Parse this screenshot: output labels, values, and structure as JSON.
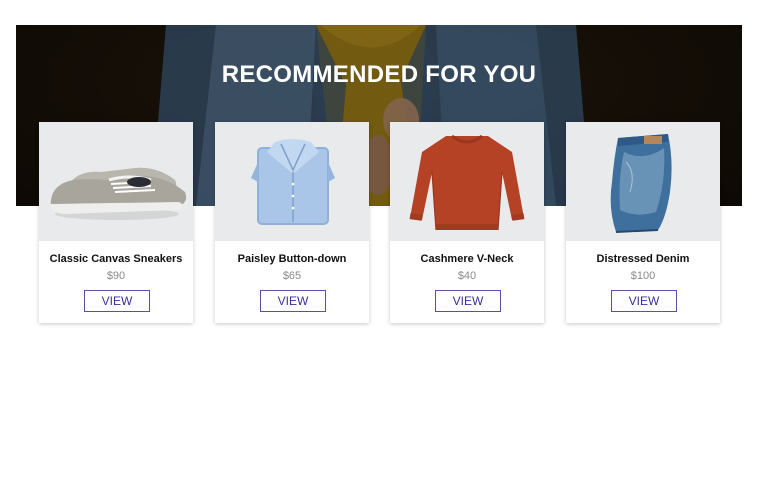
{
  "banner": {
    "title": "RECOMMENDED FOR YOU"
  },
  "colors": {
    "accent": "#3b2fa0",
    "price": "#8a8a8a",
    "card_bg": "#ffffff",
    "image_bg": "#e9eaec"
  },
  "products": [
    {
      "name": "Classic Canvas Sneakers",
      "price": "$90",
      "button": "VIEW",
      "icon": "sneakers-image"
    },
    {
      "name": "Paisley Button-down",
      "price": "$65",
      "button": "VIEW",
      "icon": "shirt-image"
    },
    {
      "name": "Cashmere V-Neck",
      "price": "$40",
      "button": "VIEW",
      "icon": "sweater-image"
    },
    {
      "name": "Distressed Denim",
      "price": "$100",
      "button": "VIEW",
      "icon": "jeans-image"
    }
  ]
}
